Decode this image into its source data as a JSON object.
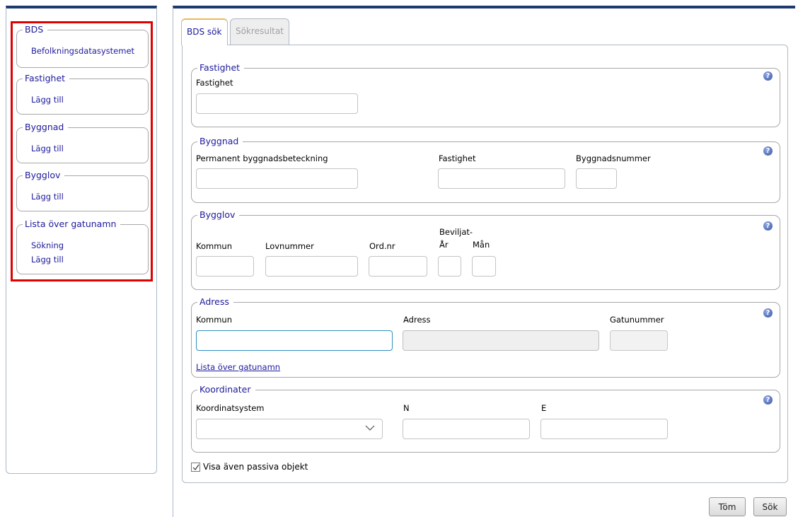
{
  "sidebar": {
    "groups": [
      {
        "title": "BDS",
        "links": [
          "Befolkningsdatasystemet"
        ]
      },
      {
        "title": "Fastighet",
        "links": [
          "Lägg till"
        ]
      },
      {
        "title": "Byggnad",
        "links": [
          "Lägg till"
        ]
      },
      {
        "title": "Bygglov",
        "links": [
          "Lägg till"
        ]
      },
      {
        "title": "Lista över gatunamn",
        "links": [
          "Sökning",
          "Lägg till"
        ]
      }
    ]
  },
  "tabs": [
    {
      "label": "BDS sök",
      "active": true
    },
    {
      "label": "Sökresultat",
      "active": false
    }
  ],
  "form": {
    "fastighet": {
      "title": "Fastighet",
      "label": "Fastighet",
      "value": ""
    },
    "byggnad": {
      "title": "Byggnad",
      "labels": {
        "permanent": "Permanent byggnadsbeteckning",
        "fastighet": "Fastighet",
        "nummer": "Byggnadsnummer"
      }
    },
    "bygglov": {
      "title": "Bygglov",
      "labels": {
        "kommun": "Kommun",
        "lovnummer": "Lovnummer",
        "ordnr": "Ord.nr",
        "beviljat": "Beviljat-",
        "ar": "År",
        "man": "Mån"
      }
    },
    "adress": {
      "title": "Adress",
      "labels": {
        "kommun": "Kommun",
        "adress": "Adress",
        "gatunummer": "Gatunummer"
      },
      "link": "Lista över gatunamn"
    },
    "koordinater": {
      "title": "Koordinater",
      "labels": {
        "system": "Koordinatsystem",
        "n": "N",
        "e": "E"
      },
      "system_selected": ""
    },
    "help_glyph": "?",
    "passive_checkbox": {
      "label": "Visa även passiva objekt",
      "checked": true
    }
  },
  "buttons": {
    "clear": "Töm",
    "search": "Sök"
  },
  "colors": {
    "accent": "#1c3a6e",
    "link": "#1d1a9c",
    "highlight": "#e00000",
    "focus": "#2e8fc2"
  }
}
